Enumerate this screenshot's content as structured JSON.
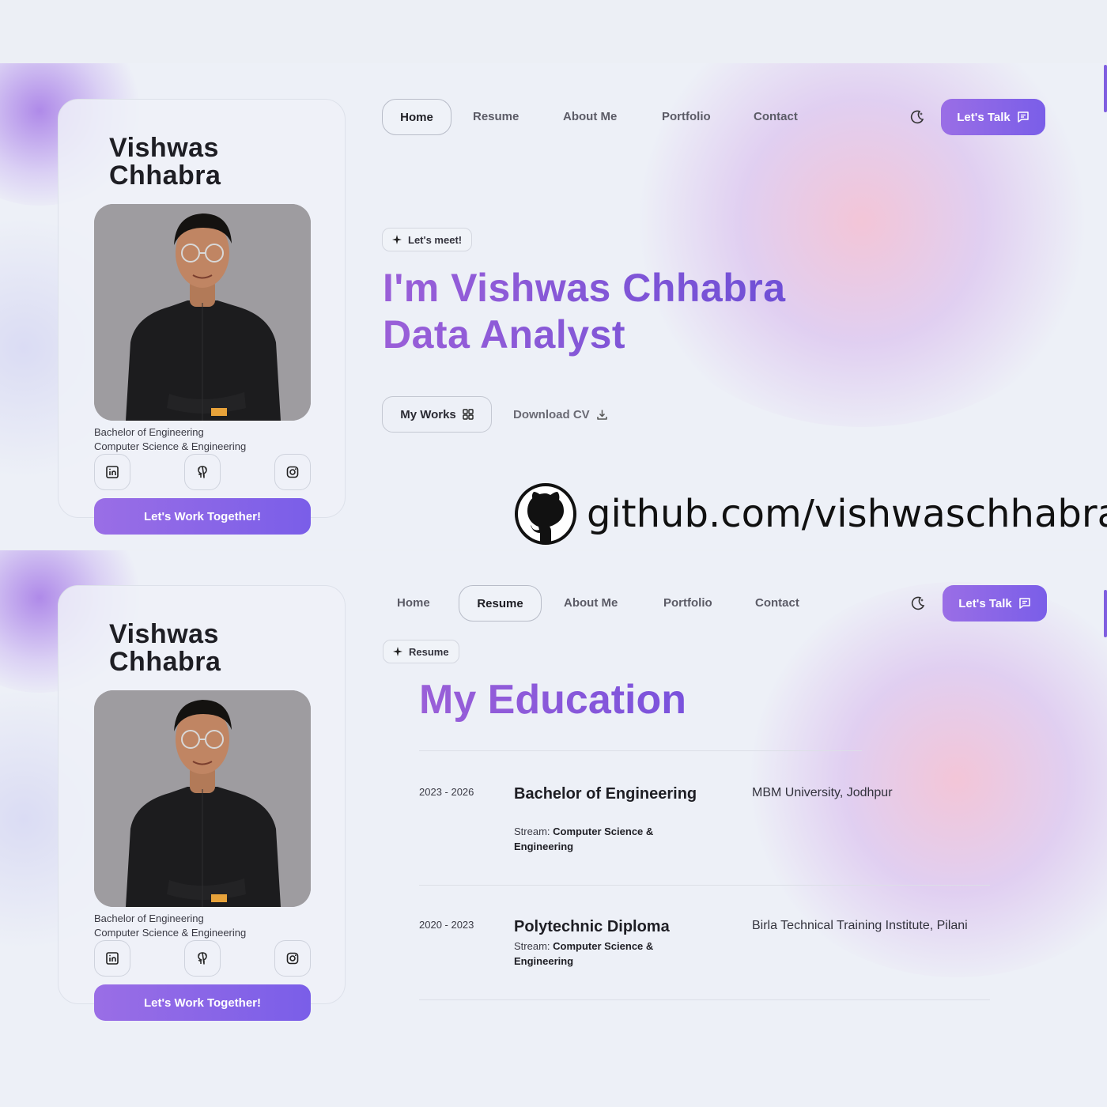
{
  "sections": [
    {
      "profile": {
        "name_line1": "Vishwas",
        "name_line2": "Chhabra",
        "degree": "Bachelor of Engineering",
        "field": "Computer Science & Engineering",
        "cta": "Let's Work Together!"
      },
      "nav": {
        "items": [
          "Home",
          "Resume",
          "About Me",
          "Portfolio",
          "Contact"
        ],
        "active": "Home",
        "talk_label": "Let's Talk"
      },
      "pill": "Let's meet!",
      "headline_line1": "I'm Vishwas Chhabra",
      "headline_line2": "Data Analyst",
      "my_works": "My Works",
      "download_cv": "Download CV"
    },
    {
      "profile": {
        "name_line1": "Vishwas",
        "name_line2": "Chhabra",
        "degree": "Bachelor of Engineering",
        "field": "Computer Science & Engineering",
        "cta": "Let's Work Together!"
      },
      "nav": {
        "items": [
          "Home",
          "Resume",
          "About Me",
          "Portfolio",
          "Contact"
        ],
        "active": "Resume",
        "talk_label": "Let's Talk"
      },
      "pill": "Resume",
      "title": "My Education",
      "education": [
        {
          "years": "2023 - 2026",
          "degree": "Bachelor of Engineering",
          "stream_label": "Stream:",
          "stream": "Computer Science & Engineering",
          "institute": "MBM University, Jodhpur"
        },
        {
          "years": "2020 - 2023",
          "degree": "Polytechnic Diploma",
          "stream_label": "Stream:",
          "stream": "Computer Science & Engineering",
          "institute": "Birla Technical Training Institute, Pilani"
        }
      ]
    }
  ],
  "github_banner": "github.com/vishwaschhabra",
  "icons": {
    "linkedin": "linkedin-icon",
    "github": "github-icon",
    "instagram": "instagram-icon",
    "theme": "moon-icon",
    "chat": "chat-icon",
    "sparkle": "sparkle-icon",
    "grid": "grid-icon",
    "download": "download-icon"
  },
  "colors": {
    "accent": "#7f5ee0",
    "accent_light": "#9a6ee6",
    "background": "#edf0f7"
  }
}
